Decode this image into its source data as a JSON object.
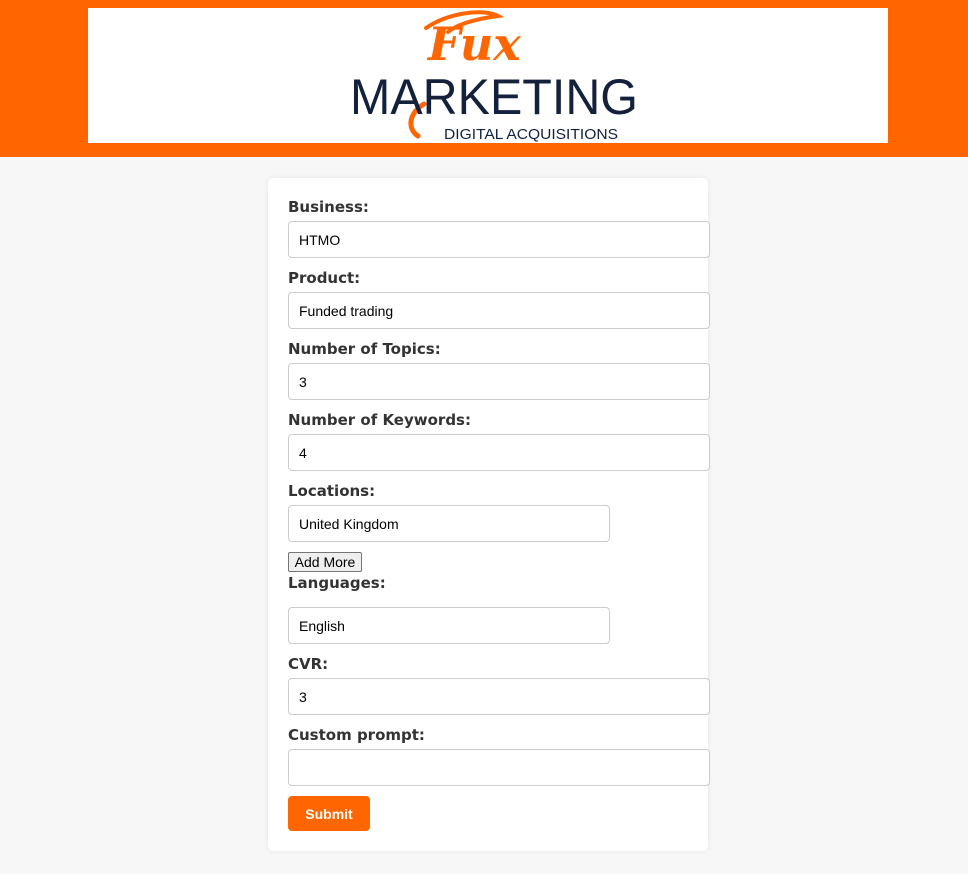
{
  "brand": {
    "script_text": "Fux",
    "wordmark": "MARKETING",
    "tagline": "DIGITAL ACQUISITIONS",
    "accent_color": "#ff6600",
    "navy_color": "#14213d"
  },
  "form": {
    "business": {
      "label": "Business:",
      "value": "HTMO"
    },
    "product": {
      "label": "Product:",
      "value": "Funded trading"
    },
    "num_topics": {
      "label": "Number of Topics:",
      "value": "3"
    },
    "num_keywords": {
      "label": "Number of Keywords:",
      "value": "4"
    },
    "locations": {
      "label": "Locations:",
      "value": "United Kingdom",
      "add_more_label": "Add More"
    },
    "languages": {
      "label": "Languages:",
      "value": "English"
    },
    "cvr": {
      "label": "CVR:",
      "value": "3"
    },
    "custom_prompt": {
      "label": "Custom prompt:",
      "value": ""
    },
    "submit_label": "Submit"
  }
}
